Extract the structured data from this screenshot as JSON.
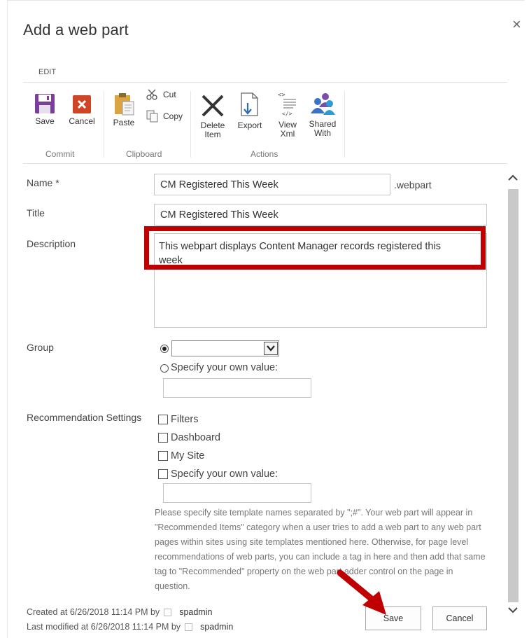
{
  "dialog": {
    "title": "Add a web part",
    "close_glyph": "×"
  },
  "ribbon": {
    "tab": "EDIT",
    "buttons": {
      "save": "Save",
      "cancel": "Cancel",
      "paste": "Paste",
      "cut": "Cut",
      "copy": "Copy",
      "delete_line1": "Delete",
      "delete_line2": "Item",
      "export": "Export",
      "viewxml_line1": "View",
      "viewxml_line2": "Xml",
      "shared_line1": "Shared",
      "shared_line2": "With"
    },
    "groups": {
      "commit": "Commit",
      "clipboard": "Clipboard",
      "actions": "Actions"
    }
  },
  "form": {
    "name": {
      "label": "Name *",
      "value": "CM Registered This Week",
      "suffix": ".webpart"
    },
    "title": {
      "label": "Title",
      "value": "CM Registered This Week"
    },
    "description": {
      "label": "Description",
      "value": "This webpart displays Content Manager records registered this week"
    },
    "group": {
      "label": "Group",
      "select_value": "",
      "radio_selected": "select",
      "own_value_label": "Specify your own value:",
      "own_value": ""
    },
    "recommendation": {
      "label": "Recommendation Settings",
      "options": [
        "Filters",
        "Dashboard",
        "My Site",
        "Specify your own value:"
      ],
      "own_value": "",
      "help": "Please specify site template names separated by \";#\". Your web part will appear in \"Recommended Items\" category when a user tries to add a web part to any web part pages within sites using site templates mentioned here. Otherwise, for page level recommendations of web parts, you can include a tag in here and then add that same tag to \"Recommended\" property on the web part adder control on the page in question."
    }
  },
  "footer": {
    "created": "Created at 6/26/2018 11:14 PM  by",
    "created_by": "spadmin",
    "modified": "Last modified at 6/26/2018 11:14 PM  by",
    "modified_by": "spadmin",
    "save": "Save",
    "cancel": "Cancel"
  },
  "colors": {
    "highlight": "#c00000",
    "save_icon": "#7b3f99",
    "cancel_icon": "#d04527"
  }
}
